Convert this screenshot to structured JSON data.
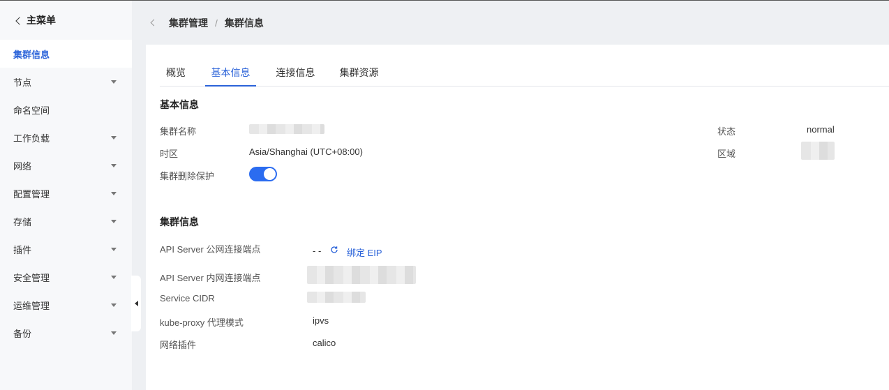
{
  "sidebar": {
    "back_label": "主菜单",
    "items": [
      {
        "label": "集群信息"
      },
      {
        "label": "节点"
      },
      {
        "label": "命名空间"
      },
      {
        "label": "工作负载"
      },
      {
        "label": "网络"
      },
      {
        "label": "配置管理"
      },
      {
        "label": "存储"
      },
      {
        "label": "插件"
      },
      {
        "label": "安全管理"
      },
      {
        "label": "运维管理"
      },
      {
        "label": "备份"
      }
    ]
  },
  "breadcrumb": {
    "parent": "集群管理",
    "separator": "/",
    "current": "集群信息"
  },
  "tabs": [
    {
      "label": "概览"
    },
    {
      "label": "基本信息"
    },
    {
      "label": "连接信息"
    },
    {
      "label": "集群资源"
    }
  ],
  "basic_info": {
    "title": "基本信息",
    "cluster_name_label": "集群名称",
    "timezone_label": "时区",
    "timezone_value": "Asia/Shanghai (UTC+08:00)",
    "delete_protection_label": "集群删除保护",
    "delete_protection_enabled": true,
    "status_label": "状态",
    "status_value": "normal",
    "region_label": "区域"
  },
  "cluster_info": {
    "title": "集群信息",
    "public_endpoint_label": "API Server 公网连接端点",
    "public_endpoint_value": "- -",
    "bind_eip_label": "绑定 EIP",
    "private_endpoint_label": "API Server 内网连接端点",
    "service_cidr_label": "Service CIDR",
    "kube_proxy_label": "kube-proxy 代理模式",
    "kube_proxy_value": "ipvs",
    "network_plugin_label": "网络插件",
    "network_plugin_value": "calico"
  },
  "colors": {
    "accent": "#2b63d9",
    "toggle_on": "#2b6cf0"
  }
}
